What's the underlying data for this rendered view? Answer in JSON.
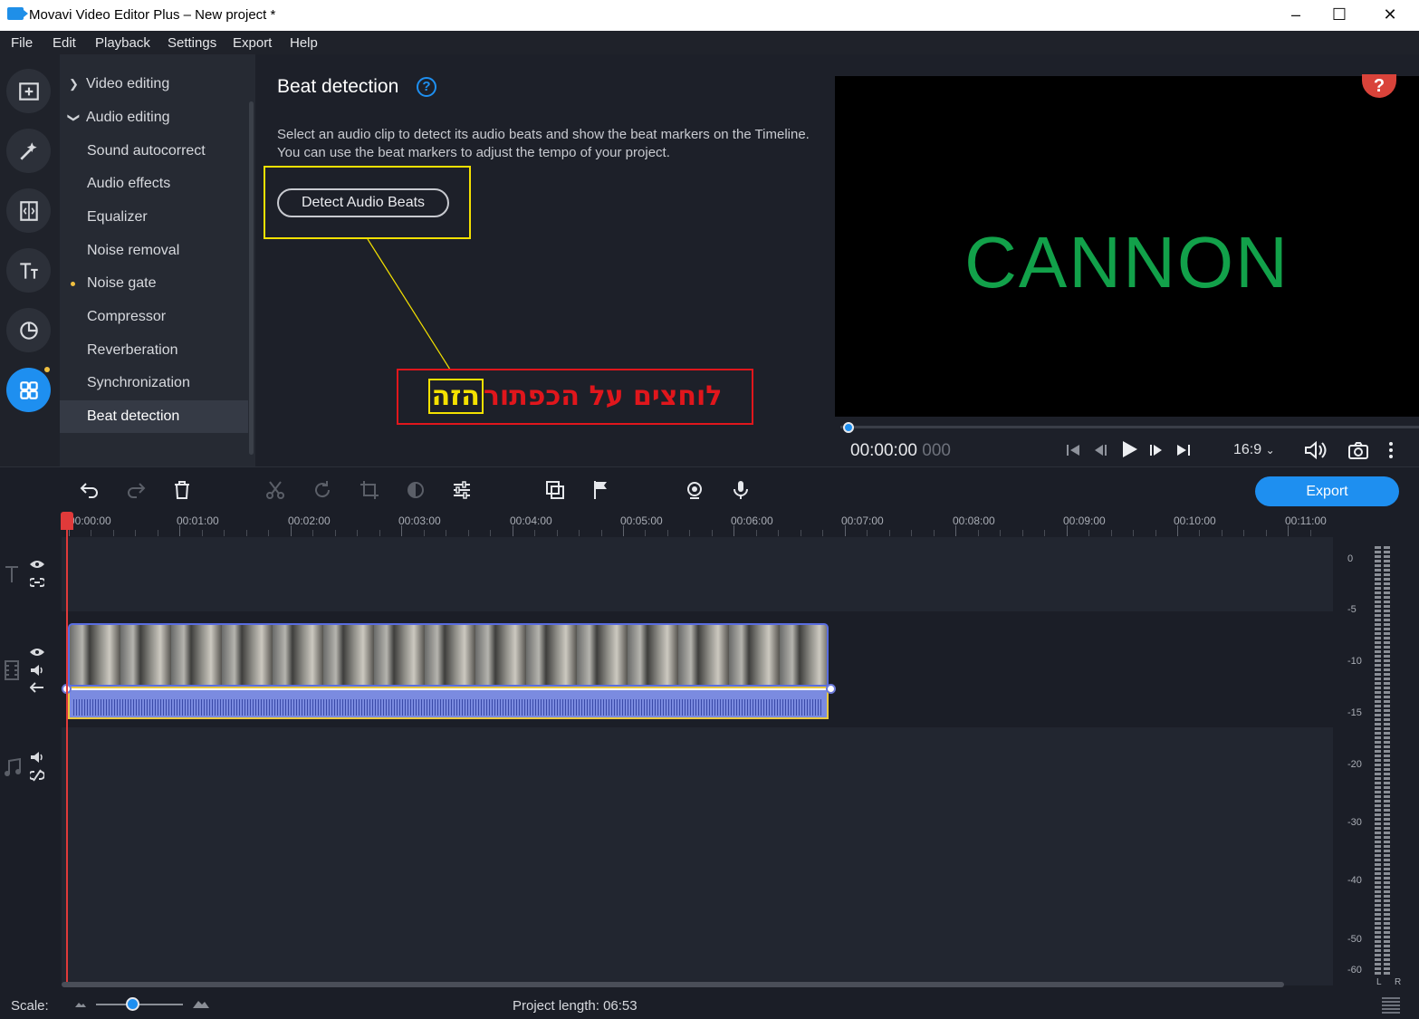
{
  "window": {
    "title": "Movavi Video Editor Plus – New project *",
    "minimize_glyph": "–",
    "maximize_glyph": "☐",
    "close_glyph": "✕"
  },
  "menubar": [
    "File",
    "Edit",
    "Playback",
    "Settings",
    "Export",
    "Help"
  ],
  "iconbar": [
    {
      "icon": "import-media-icon",
      "active": false
    },
    {
      "icon": "magic-wand-icon",
      "active": false
    },
    {
      "icon": "transitions-icon",
      "active": false
    },
    {
      "icon": "titles-icon",
      "active": false
    },
    {
      "icon": "stickers-icon",
      "active": false
    },
    {
      "icon": "more-tools-icon",
      "active": true
    }
  ],
  "sidemenu": {
    "items": [
      {
        "label": "Video editing",
        "level": 0,
        "expanded": false
      },
      {
        "label": "Audio editing",
        "level": 0,
        "expanded": true
      },
      {
        "label": "Sound autocorrect",
        "level": 1
      },
      {
        "label": "Audio effects",
        "level": 1
      },
      {
        "label": "Equalizer",
        "level": 1
      },
      {
        "label": "Noise removal",
        "level": 1
      },
      {
        "label": "Noise gate",
        "level": 1,
        "dot": true
      },
      {
        "label": "Compressor",
        "level": 1
      },
      {
        "label": "Reverberation",
        "level": 1
      },
      {
        "label": "Synchronization",
        "level": 1
      },
      {
        "label": "Beat detection",
        "level": 1,
        "selected": true
      }
    ]
  },
  "panel": {
    "heading": "Beat detection",
    "help_glyph": "?",
    "description": "Select an audio clip to detect its audio beats and show the beat markers on the Timeline. You can use the beat markers to adjust the tempo of your project.",
    "detect_button": "Detect Audio Beats",
    "callout_main": "לוחצים על הכפתור",
    "callout_highlight": "הזה"
  },
  "preview": {
    "text": "CANNON",
    "help_glyph": "?",
    "text_color": "#12a14a"
  },
  "player": {
    "timecode": "00:00:00",
    "timecode_ms": "000",
    "aspect_ratio": "16:9",
    "progress": 0
  },
  "toolbar": {
    "export_label": "Export"
  },
  "ruler": {
    "labels": [
      "00:00:00",
      "00:01:00",
      "00:02:00",
      "00:03:00",
      "00:04:00",
      "00:05:00",
      "00:06:00",
      "00:07:00",
      "00:08:00",
      "00:09:00",
      "00:10:00",
      "00:11:00"
    ]
  },
  "vu_meter": {
    "labels": [
      "0",
      "-5",
      "-10",
      "-15",
      "-20",
      "-30",
      "-40",
      "-50",
      "-60"
    ],
    "left": "L",
    "right": "R"
  },
  "status": {
    "scale_label": "Scale:",
    "project_length_label": "Project length:",
    "project_length_value": "06:53"
  },
  "colors": {
    "accent": "#1e8ff0",
    "playhead": "#e03a3a",
    "highlight": "#f4e100",
    "callout": "#e0161c"
  }
}
